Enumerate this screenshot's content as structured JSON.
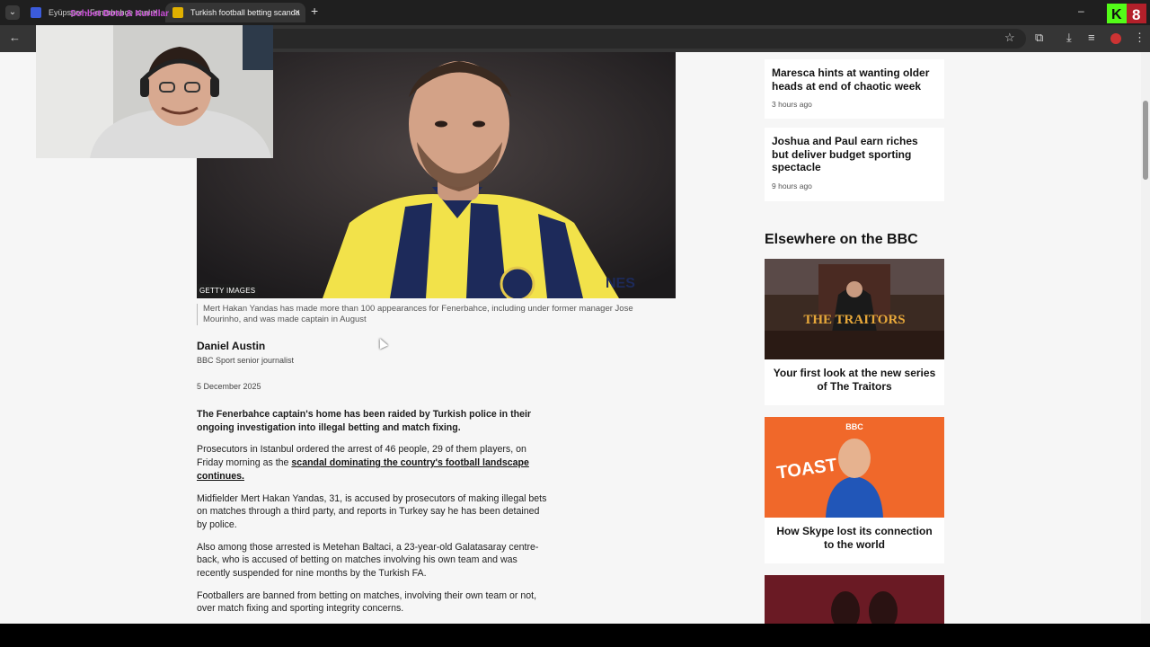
{
  "browser": {
    "tabs": [
      {
        "title": "Eyüpspor - Fenerbahçe canlı",
        "active": false,
        "favicon_color": "#3b5bdb"
      },
      {
        "title": "Turkish football betting scanda",
        "active": true,
        "favicon_color": "#e0b000"
      }
    ],
    "new_tab_icon": "plus-icon",
    "overlay_text": "Sohbet Botu & Kurallar"
  },
  "article": {
    "image_credit": "GETTY IMAGES",
    "caption": "Mert Hakan Yandas has made more than 100 appearances for Fenerbahce, including under former manager Jose Mourinho, and was made captain in August",
    "author": "Daniel Austin",
    "author_role": "BBC Sport senior journalist",
    "date": "5 December 2025",
    "lead": "The Fenerbahce captain's home has been raided by Turkish police in their ongoing investigation into illegal betting and match fixing.",
    "p1_start": "Prosecutors in Istanbul ordered the arrest of 46 people, 29 of them players, on Friday morning as the ",
    "p1_link": "scandal dominating the country's football landscape continues.",
    "p2": "Midfielder Mert Hakan Yandas, 31, is accused by prosecutors of making illegal bets on matches through a third party, and reports in Turkey say he has been detained by police.",
    "p3": "Also among those arrested is Metehan Baltaci, a 23-year-old Galatasaray centre-back, who is accused of betting on matches involving his own team and was recently suspended for nine months by the Turkish FA.",
    "p4": "Footballers are banned from betting on matches, involving their own team or not, over match fixing and sporting integrity concerns."
  },
  "sidebar": {
    "stories": [
      {
        "headline": "Maresca hints at wanting older heads at end of chaotic week",
        "time": "3 hours ago"
      },
      {
        "headline": "Joshua and Paul earn riches but deliver budget sporting spectacle",
        "time": "9 hours ago"
      }
    ],
    "section_title": "Elsewhere on the BBC",
    "promos": [
      {
        "headline": "Your first look at the new series of The Traitors",
        "image_text": "THE TRAITORS"
      },
      {
        "headline": "How Skype lost its connection to the world",
        "image_text": "TOAST",
        "brand": "BBC"
      }
    ]
  },
  "stream_badge": {
    "letter": "K",
    "number": "8"
  },
  "colors": {
    "page_bg": "#f6f6f6",
    "text": "#141414",
    "jersey_yellow": "#f2e24a",
    "jersey_navy": "#1d2a5a"
  }
}
